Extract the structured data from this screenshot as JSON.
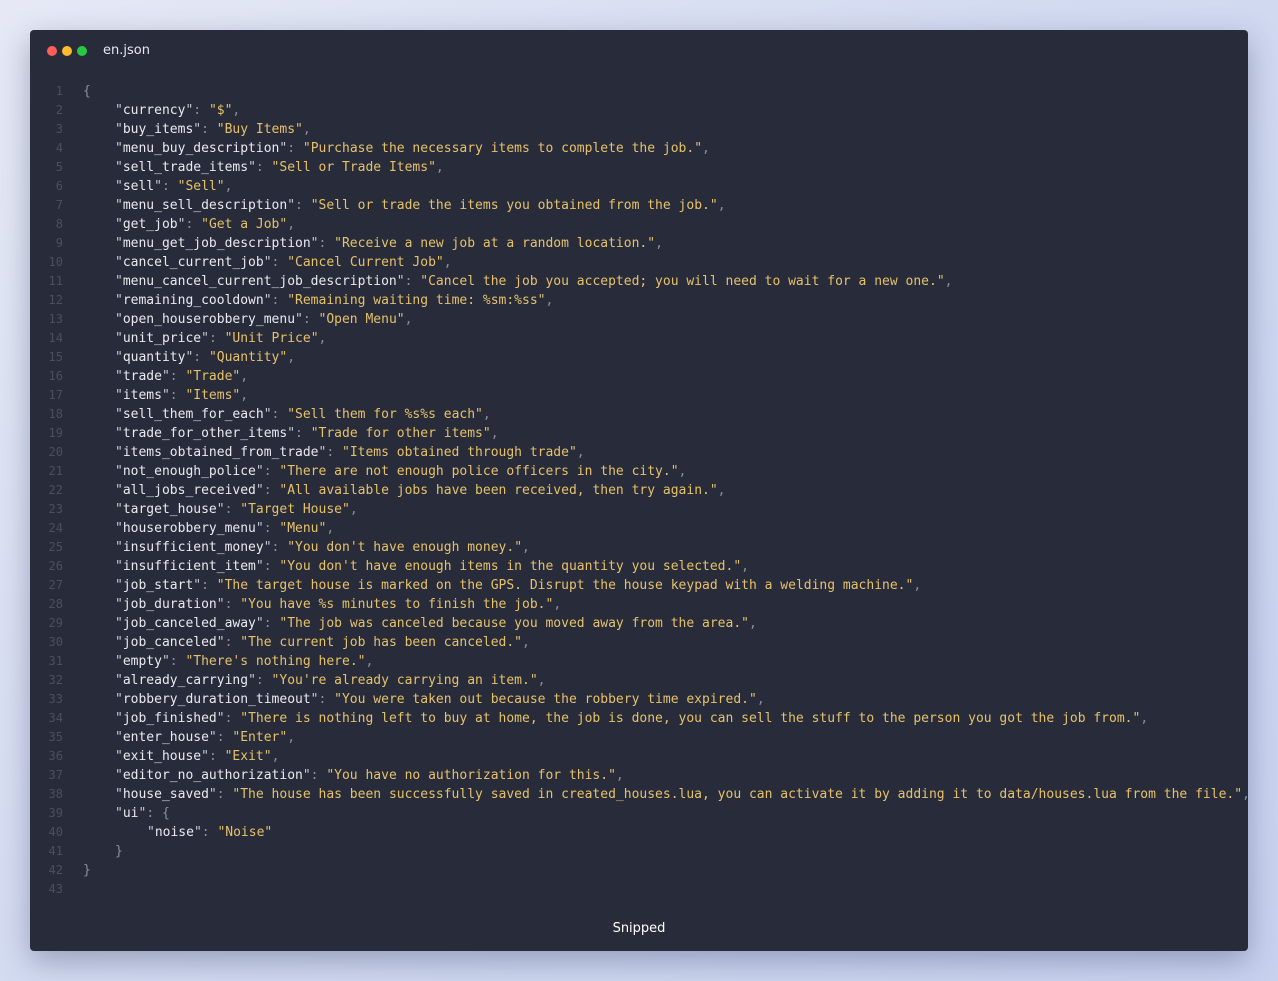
{
  "window": {
    "filename": "en.json",
    "footer": "Snipped"
  },
  "lines": [
    {
      "n": "1",
      "indent": 0,
      "kind": "open",
      "text": "{"
    },
    {
      "n": "2",
      "indent": 1,
      "kind": "pair",
      "key": "currency",
      "value": "$"
    },
    {
      "n": "3",
      "indent": 1,
      "kind": "pair",
      "key": "buy_items",
      "value": "Buy Items"
    },
    {
      "n": "4",
      "indent": 1,
      "kind": "pair",
      "key": "menu_buy_description",
      "value": "Purchase the necessary items to complete the job."
    },
    {
      "n": "5",
      "indent": 1,
      "kind": "pair",
      "key": "sell_trade_items",
      "value": "Sell or Trade Items"
    },
    {
      "n": "6",
      "indent": 1,
      "kind": "pair",
      "key": "sell",
      "value": "Sell"
    },
    {
      "n": "7",
      "indent": 1,
      "kind": "pair",
      "key": "menu_sell_description",
      "value": "Sell or trade the items you obtained from the job."
    },
    {
      "n": "8",
      "indent": 1,
      "kind": "pair",
      "key": "get_job",
      "value": "Get a Job"
    },
    {
      "n": "9",
      "indent": 1,
      "kind": "pair",
      "key": "menu_get_job_description",
      "value": "Receive a new job at a random location."
    },
    {
      "n": "10",
      "indent": 1,
      "kind": "pair",
      "key": "cancel_current_job",
      "value": "Cancel Current Job"
    },
    {
      "n": "11",
      "indent": 1,
      "kind": "pair",
      "key": "menu_cancel_current_job_description",
      "value": "Cancel the job you accepted; you will need to wait for a new one."
    },
    {
      "n": "12",
      "indent": 1,
      "kind": "pair",
      "key": "remaining_cooldown",
      "value": "Remaining waiting time: %sm:%ss"
    },
    {
      "n": "13",
      "indent": 1,
      "kind": "pair",
      "key": "open_houserobbery_menu",
      "value": "Open Menu"
    },
    {
      "n": "14",
      "indent": 1,
      "kind": "pair",
      "key": "unit_price",
      "value": "Unit Price"
    },
    {
      "n": "15",
      "indent": 1,
      "kind": "pair",
      "key": "quantity",
      "value": "Quantity"
    },
    {
      "n": "16",
      "indent": 1,
      "kind": "pair",
      "key": "trade",
      "value": "Trade"
    },
    {
      "n": "17",
      "indent": 1,
      "kind": "pair",
      "key": "items",
      "value": "Items"
    },
    {
      "n": "18",
      "indent": 1,
      "kind": "pair",
      "key": "sell_them_for_each",
      "value": "Sell them for %s%s each"
    },
    {
      "n": "19",
      "indent": 1,
      "kind": "pair",
      "key": "trade_for_other_items",
      "value": "Trade for other items"
    },
    {
      "n": "20",
      "indent": 1,
      "kind": "pair",
      "key": "items_obtained_from_trade",
      "value": "Items obtained through trade"
    },
    {
      "n": "21",
      "indent": 1,
      "kind": "pair",
      "key": "not_enough_police",
      "value": "There are not enough police officers in the city."
    },
    {
      "n": "22",
      "indent": 1,
      "kind": "pair",
      "key": "all_jobs_received",
      "value": "All available jobs have been received, then try again."
    },
    {
      "n": "23",
      "indent": 1,
      "kind": "pair",
      "key": "target_house",
      "value": "Target House"
    },
    {
      "n": "24",
      "indent": 1,
      "kind": "pair",
      "key": "houserobbery_menu",
      "value": "Menu"
    },
    {
      "n": "25",
      "indent": 1,
      "kind": "pair",
      "key": "insufficient_money",
      "value": "You don't have enough money."
    },
    {
      "n": "26",
      "indent": 1,
      "kind": "pair",
      "key": "insufficient_item",
      "value": "You don't have enough items in the quantity you selected."
    },
    {
      "n": "27",
      "indent": 1,
      "kind": "pair",
      "key": "job_start",
      "value": "The target house is marked on the GPS. Disrupt the house keypad with a welding machine."
    },
    {
      "n": "28",
      "indent": 1,
      "kind": "pair",
      "key": "job_duration",
      "value": "You have %s minutes to finish the job."
    },
    {
      "n": "29",
      "indent": 1,
      "kind": "pair",
      "key": "job_canceled_away",
      "value": "The job was canceled because you moved away from the area."
    },
    {
      "n": "30",
      "indent": 1,
      "kind": "pair",
      "key": "job_canceled",
      "value": "The current job has been canceled."
    },
    {
      "n": "31",
      "indent": 1,
      "kind": "pair",
      "key": "empty",
      "value": "There's nothing here."
    },
    {
      "n": "32",
      "indent": 1,
      "kind": "pair",
      "key": "already_carrying",
      "value": "You're already carrying an item."
    },
    {
      "n": "33",
      "indent": 1,
      "kind": "pair",
      "key": "robbery_duration_timeout",
      "value": "You were taken out because the robbery time expired."
    },
    {
      "n": "34",
      "indent": 1,
      "kind": "pair",
      "key": "job_finished",
      "value": "There is nothing left to buy at home, the job is done, you can sell the stuff to the person you got the job from."
    },
    {
      "n": "35",
      "indent": 1,
      "kind": "pair",
      "key": "enter_house",
      "value": "Enter"
    },
    {
      "n": "36",
      "indent": 1,
      "kind": "pair",
      "key": "exit_house",
      "value": "Exit"
    },
    {
      "n": "37",
      "indent": 1,
      "kind": "pair",
      "key": "editor_no_authorization",
      "value": "You have no authorization for this."
    },
    {
      "n": "38",
      "indent": 1,
      "kind": "pair",
      "key": "house_saved",
      "value": "The house has been successfully saved in created_houses.lua, you can activate it by adding it to data/houses.lua from the file."
    },
    {
      "n": "39",
      "indent": 1,
      "kind": "objkey",
      "key": "ui"
    },
    {
      "n": "40",
      "indent": 2,
      "kind": "last",
      "key": "noise",
      "value": "Noise"
    },
    {
      "n": "41",
      "indent": 1,
      "kind": "close",
      "text": "}"
    },
    {
      "n": "42",
      "indent": 0,
      "kind": "close",
      "text": "}"
    },
    {
      "n": "43",
      "indent": 0,
      "kind": "empty",
      "text": ""
    }
  ]
}
